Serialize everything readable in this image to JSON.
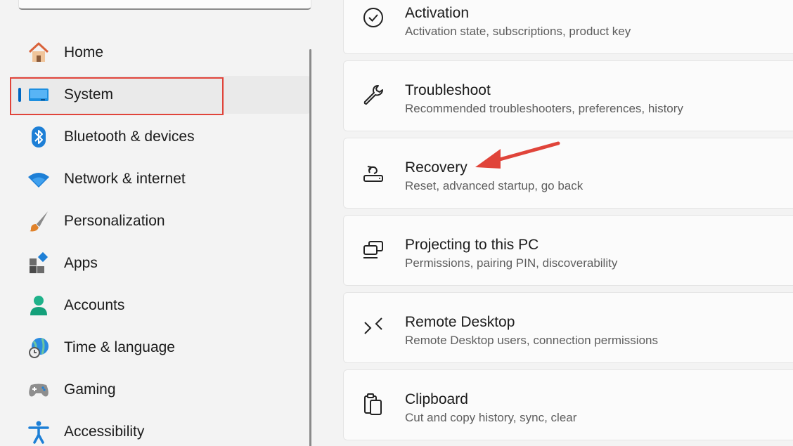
{
  "sidebar": {
    "items": [
      {
        "label": "Home",
        "icon": "home-icon"
      },
      {
        "label": "System",
        "icon": "system-icon"
      },
      {
        "label": "Bluetooth & devices",
        "icon": "bluetooth-icon"
      },
      {
        "label": "Network & internet",
        "icon": "wifi-icon"
      },
      {
        "label": "Personalization",
        "icon": "brush-icon"
      },
      {
        "label": "Apps",
        "icon": "apps-icon"
      },
      {
        "label": "Accounts",
        "icon": "account-icon"
      },
      {
        "label": "Time & language",
        "icon": "globe-clock-icon"
      },
      {
        "label": "Gaming",
        "icon": "controller-icon"
      },
      {
        "label": "Accessibility",
        "icon": "accessibility-icon"
      }
    ],
    "selected": "System"
  },
  "cards": [
    {
      "title": "Activation",
      "subtitle": "Activation state, subscriptions, product key",
      "icon": "check-circle-icon"
    },
    {
      "title": "Troubleshoot",
      "subtitle": "Recommended troubleshooters, preferences, history",
      "icon": "wrench-icon"
    },
    {
      "title": "Recovery",
      "subtitle": "Reset, advanced startup, go back",
      "icon": "recovery-icon"
    },
    {
      "title": "Projecting to this PC",
      "subtitle": "Permissions, pairing PIN, discoverability",
      "icon": "projector-icon"
    },
    {
      "title": "Remote Desktop",
      "subtitle": "Remote Desktop users, connection permissions",
      "icon": "remote-desktop-icon"
    },
    {
      "title": "Clipboard",
      "subtitle": "Cut and copy history, sync, clear",
      "icon": "clipboard-icon"
    }
  ],
  "colors": {
    "accent": "#0067c0",
    "annotation": "#e0443a"
  }
}
